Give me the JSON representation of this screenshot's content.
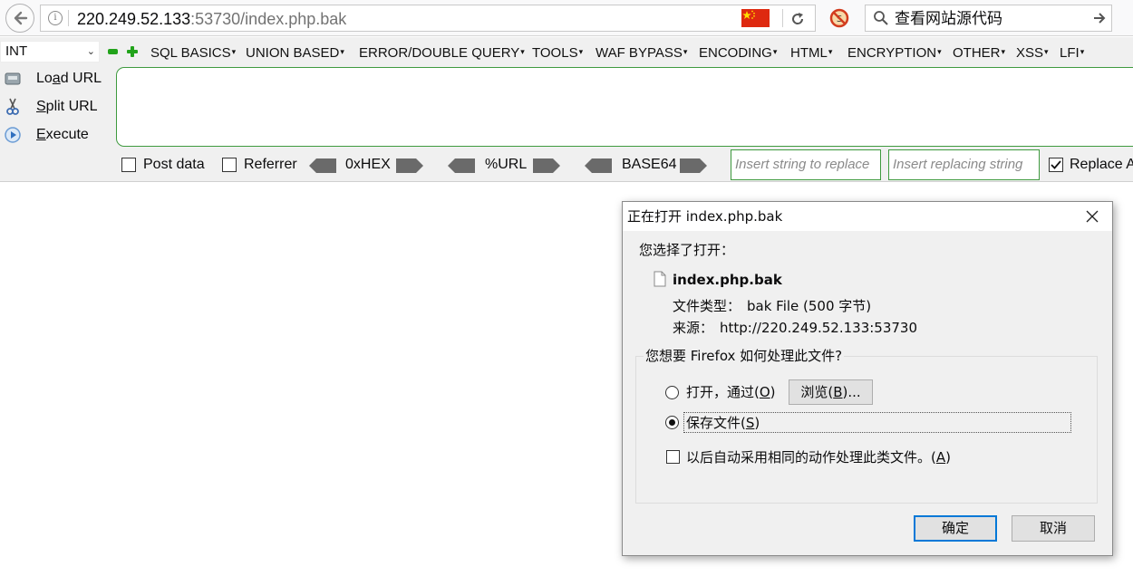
{
  "browser": {
    "url_host": "220.249.52.133",
    "url_rest": ":53730/index.php.bak",
    "search_text": "查看网站源代码",
    "icons": {
      "back": "back-arrow-icon",
      "info": "info-icon",
      "flag": "china-flag-icon",
      "reload": "reload-icon",
      "noscript": "noscript-icon",
      "search": "search-icon",
      "go": "go-arrow-icon"
    }
  },
  "hackbar": {
    "type_select": "INT",
    "menu": [
      "SQL BASICS",
      "UNION BASED",
      "ERROR/DOUBLE QUERY",
      "TOOLS",
      "WAF BYPASS",
      "ENCODING",
      "HTML",
      "ENCRYPTION",
      "OTHER",
      "XSS",
      "LFI"
    ],
    "load_url": {
      "pre": "Lo",
      "key": "a",
      "post": "d URL"
    },
    "split_url": {
      "pre": "",
      "key": "S",
      "post": "plit URL"
    },
    "execute": {
      "pre": "",
      "key": "E",
      "post": "xecute"
    },
    "post_data_label": "Post data",
    "referrer_label": "Referrer",
    "hex_label": "0xHEX",
    "url_label": "%URL",
    "base64_label": "BASE64",
    "insert_placeholder": "Insert string to replace",
    "replacing_placeholder": "Insert replacing string",
    "replace_all_label": "Replace All",
    "replace_all_checked": true,
    "accent_color": "#3f9a3f"
  },
  "dialog": {
    "title": "正在打开 index.php.bak",
    "chosen_label": "您选择了打开：",
    "file_name": "index.php.bak",
    "file_type_label": "文件类型：",
    "file_type_value": "bak File (500 字节)",
    "source_label": "来源：",
    "source_value": "http://220.249.52.133:53730",
    "question": "您想要 Firefox 如何处理此文件?",
    "open_with": {
      "pre": "打开，通过(",
      "key": "O",
      "post": ")"
    },
    "browse": {
      "pre": "浏览(",
      "key": "B",
      "post": ")..."
    },
    "save_file": {
      "pre": "保存文件(",
      "key": "S",
      "post": ")"
    },
    "auto_action": {
      "pre": "以后自动采用相同的动作处理此类文件。(",
      "key": "A",
      "post": ")"
    },
    "selected_option": "save_file",
    "ok_label": "确定",
    "cancel_label": "取消"
  }
}
